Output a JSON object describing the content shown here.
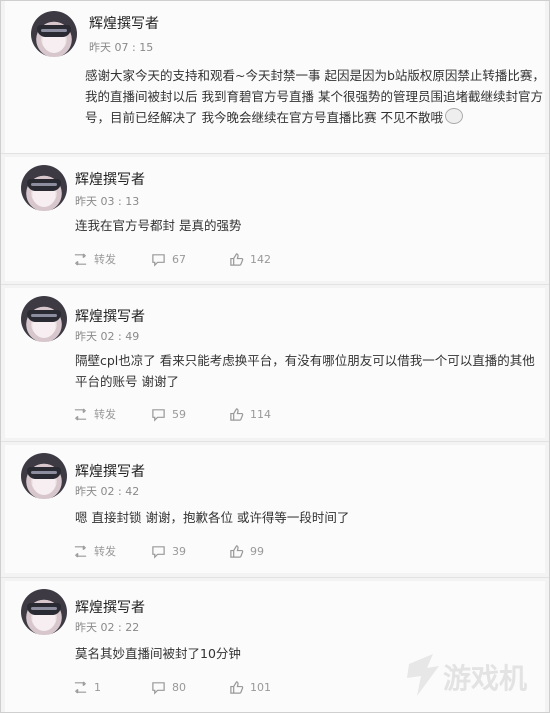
{
  "posts": [
    {
      "author": "辉煌撰写者",
      "time": "昨天 07 : 15",
      "content_lines": [
        "感谢大家今天的支持和观看~今天封禁一事   起因是因为b站版权原因禁止转播比赛，",
        "我的直播间被封以后  我到育碧官方号直播  某个很强势的管理员围追堵截继续封官方",
        "号，目前已经解决了 我今晚会继续在官方号直播比赛 不见不散哦"
      ]
    },
    {
      "author": "辉煌撰写者",
      "time": "昨天 03 : 13",
      "content_lines": [
        "连我在官方号都封 是真的强势"
      ],
      "repost": "转发",
      "comments": "67",
      "likes": "142"
    },
    {
      "author": "辉煌撰写者",
      "time": "昨天 02 : 49",
      "content_lines": [
        "隔壁cpl也凉了   看来只能考虑换平台，有没有哪位朋友可以借我一个可以直播的其他",
        "平台的账号 谢谢了"
      ],
      "repost": "转发",
      "comments": "59",
      "likes": "114"
    },
    {
      "author": "辉煌撰写者",
      "time": "昨天 02 : 42",
      "content_lines": [
        "嗯 直接封锁 谢谢，抱歉各位 或许得等一段时间了"
      ],
      "repost": "转发",
      "comments": "39",
      "likes": "99"
    },
    {
      "author": "辉煌撰写者",
      "time": "昨天 02 : 22",
      "content_lines": [
        "莫名其妙直播间被封了10分钟"
      ],
      "repost": "1",
      "comments": "80",
      "likes": "101"
    }
  ],
  "watermark_text": "游戏机",
  "colors": {
    "accent": "#f5a623",
    "meta": "#999999"
  }
}
